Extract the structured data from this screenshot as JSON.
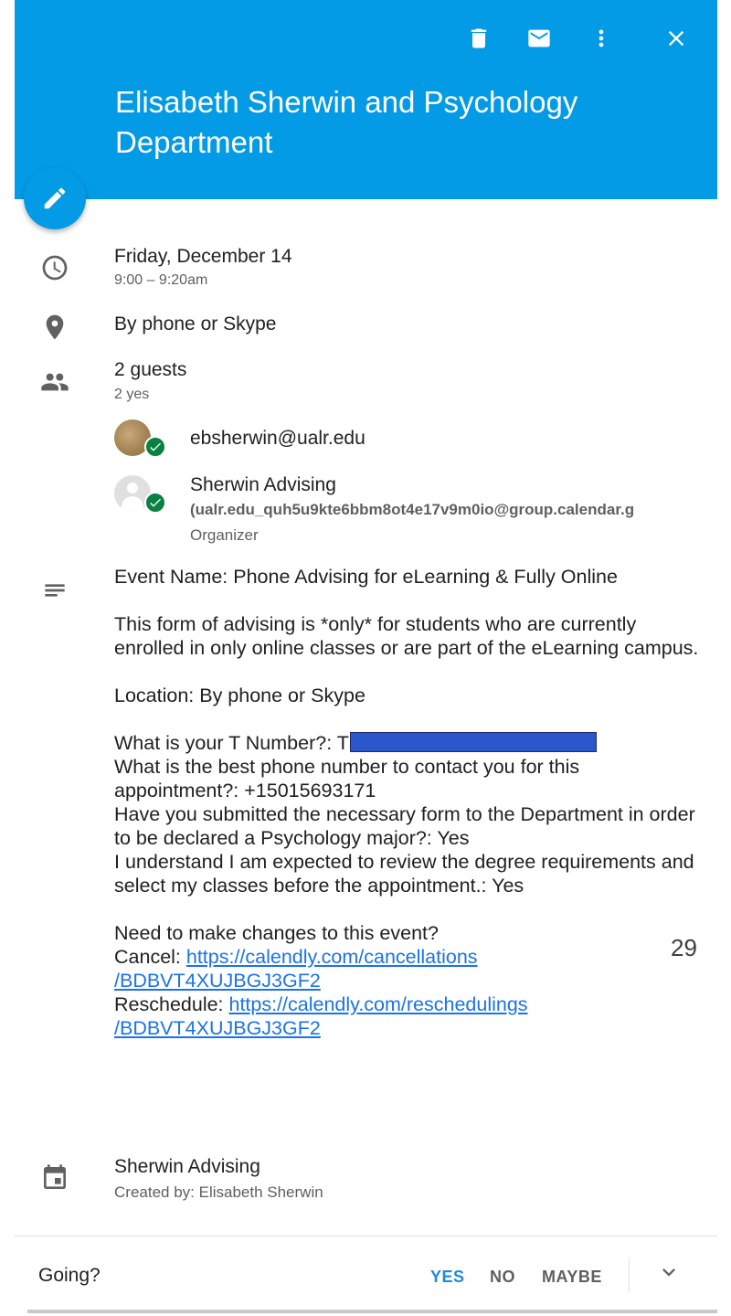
{
  "header": {
    "title": "Elisabeth Sherwin and Psychology Department",
    "icons": [
      "trash-icon",
      "mail-icon",
      "more-vert-icon",
      "close-icon"
    ],
    "background": "#039be5"
  },
  "fab": {
    "icon": "edit-icon"
  },
  "event": {
    "date": "Friday, December 14",
    "time": "9:00 – 9:20am",
    "location": "By phone or Skype",
    "guests_count": "2 guests",
    "guests_summary": "2 yes"
  },
  "guests": [
    {
      "name": "ebsherwin@ualr.edu"
    },
    {
      "name": "Sherwin Advising",
      "detail": "(ualr.edu_quh5u9kte6bbm8ot4e17v9m0io@group.calendar.g",
      "role": "Organizer"
    }
  ],
  "description": {
    "event_name": "Event Name: Phone Advising for eLearning & Fully Online",
    "intro": "This form of advising is *only* for students who are currently enrolled in only online classes or are part of the eLearning campus.",
    "location": "Location: By phone or Skype",
    "t_number_q": "What is your T Number?: T",
    "phone_q": "What is the best phone number to contact you for this appointment?: +15015693171",
    "form_q": "Have you submitted the necessary form to the Department in order to be declared a Psychology major?: Yes",
    "understand_q": "I understand I am expected to review the degree requirements and select my classes before the appointment.: Yes",
    "changes": "Need to make changes to this event?",
    "cancel_label": "Cancel: ",
    "cancel_link_1": "https://calendly.com/cancellations",
    "cancel_link_2": "/BDBVT4XUJBGJ3GF2",
    "reschedule_label": "Reschedule: ",
    "reschedule_link_1": "https://calendly.com/reschedulings",
    "reschedule_link_2": "/BDBVT4XUJBGJ3GF2"
  },
  "calendar": {
    "name": "Sherwin Advising",
    "created_by": "Created by: Elisabeth Sherwin"
  },
  "footer": {
    "going_label": "Going?",
    "yes": "YES",
    "no": "NO",
    "maybe": "MAYBE",
    "accent": "#1e88e5"
  },
  "page_number": "29"
}
